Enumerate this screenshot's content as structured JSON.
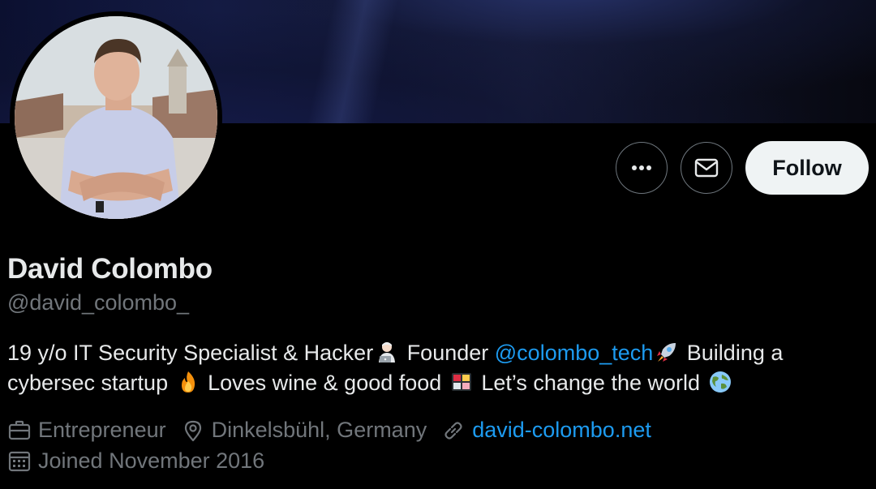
{
  "profile": {
    "name": "David Colombo",
    "handle": "@david_colombo_",
    "bio": {
      "part1": "19 y/o IT Security Specialist & Hacker",
      "part2": " Founder ",
      "mention": "@colombo_tech",
      "part3": " Building a cybersec startup ",
      "part4": " Loves wine & good food ",
      "part5": " Let’s change the world "
    },
    "profession": "Entrepreneur",
    "location": "Dinkelsbühl, Germany",
    "website": "david-colombo.net",
    "joined": "Joined November 2016"
  },
  "actions": {
    "more_icon": "more-horizontal-icon",
    "message_icon": "envelope-icon",
    "follow_label": "Follow"
  },
  "icons": {
    "profession": "briefcase-icon",
    "location": "location-pin-icon",
    "website": "link-icon",
    "joined": "calendar-icon"
  },
  "colors": {
    "link": "#1d9bf0",
    "secondary_text": "#71767b",
    "primary_text": "#e7e9ea",
    "follow_bg": "#eff3f4"
  }
}
